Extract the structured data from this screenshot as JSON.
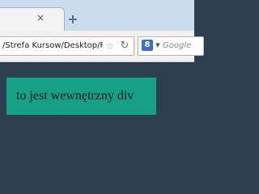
{
  "tab_bar": {
    "close_glyph": "×",
    "new_tab_glyph": "+"
  },
  "toolbar": {
    "address_value": "/Strefa Kursow/Desktop/Ro:",
    "star_glyph": "☆",
    "reload_glyph": "↻",
    "search_engine_badge": "8",
    "search_engine_dropdown_glyph": "▼",
    "search_placeholder": "Google"
  },
  "page": {
    "inner_div_text": "to jest wewnętrzny div"
  },
  "colors": {
    "page_background": "#2c3e50",
    "inner_div_background": "#16a085",
    "tab_strip": "#cbdcee"
  }
}
